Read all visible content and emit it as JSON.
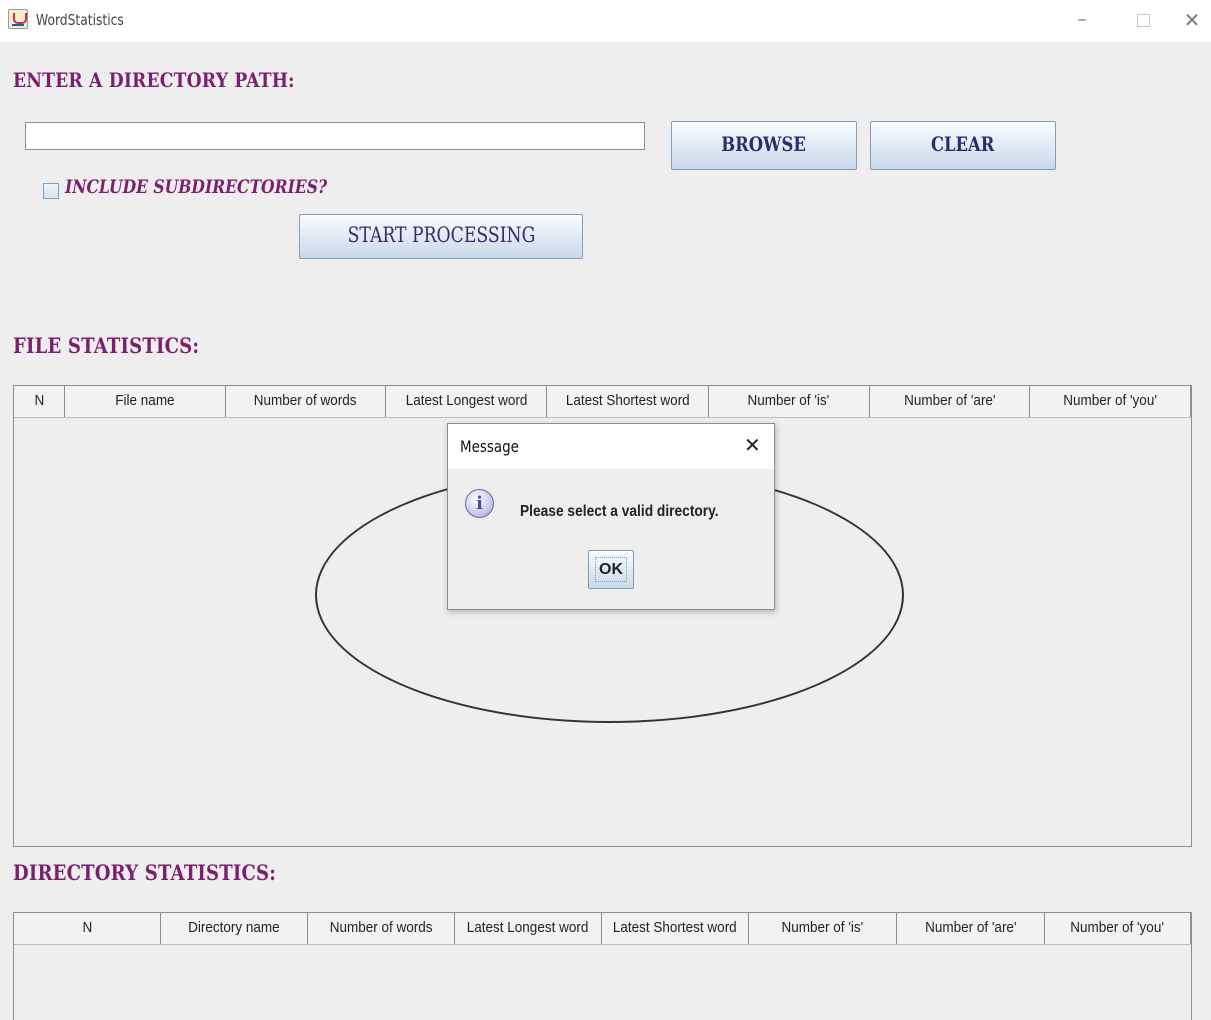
{
  "window": {
    "title": "WordStatistics",
    "minimize": "–",
    "close": "✕"
  },
  "directory_section": {
    "label": "ENTER A DIRECTORY PATH:",
    "path_value": "",
    "path_placeholder": ""
  },
  "buttons": {
    "browse": "BROWSE",
    "clear": "CLEAR",
    "start": "START PROCESSING"
  },
  "subdirectories_checkbox": {
    "label": "INCLUDE SUBDIRECTORIES?",
    "checked": false
  },
  "file_statistics": {
    "label": "FILE STATISTICS:",
    "columns": [
      "N",
      "File name",
      "Number of words",
      "Latest Longest word",
      "Latest Shortest word",
      "Number of 'is'",
      "Number of 'are'",
      "Number of 'you'"
    ],
    "rows": []
  },
  "directory_statistics": {
    "label": "DIRECTORY STATISTICS:",
    "columns": [
      "N",
      "Directory name",
      "Number of words",
      "Latest Longest word",
      "Latest Shortest word",
      "Number of 'is'",
      "Number of 'are'",
      "Number of 'you'"
    ],
    "rows": []
  },
  "dialog": {
    "title": "Message",
    "close": "✕",
    "icon": "info-icon",
    "icon_glyph": "i",
    "message": "Please select a valid directory.",
    "ok": "OK"
  },
  "colors": {
    "section_label": "#7b1f6e",
    "button_gradient_top": "#fbfdff",
    "button_gradient_bottom": "#c9d9ea",
    "background": "#eeeeee"
  }
}
